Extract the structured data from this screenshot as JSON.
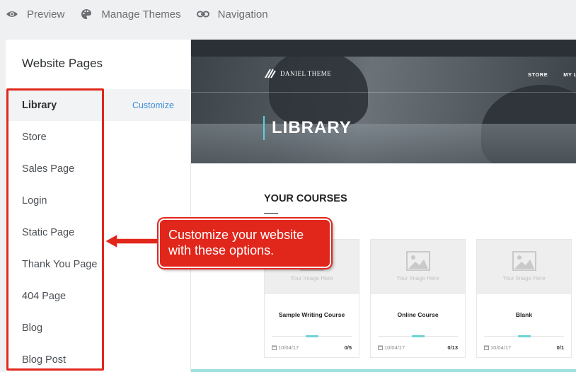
{
  "topnav": {
    "items": [
      {
        "label": "Preview",
        "icon": "eye-icon"
      },
      {
        "label": "Manage Themes",
        "icon": "palette-icon"
      },
      {
        "label": "Navigation",
        "icon": "link-icon"
      }
    ]
  },
  "sidebar": {
    "title": "Website Pages",
    "customize_label": "Customize",
    "items": [
      {
        "label": "Library",
        "active": true
      },
      {
        "label": "Store"
      },
      {
        "label": "Sales Page"
      },
      {
        "label": "Login"
      },
      {
        "label": "Static Page"
      },
      {
        "label": "Thank You Page"
      },
      {
        "label": "404 Page"
      },
      {
        "label": "Blog"
      },
      {
        "label": "Blog Post"
      }
    ]
  },
  "annotation": {
    "callout_text": "Customize your website with these options.",
    "color": "#e1261c"
  },
  "preview": {
    "logo_text": "DANIEL THEME",
    "menu": [
      "STORE",
      "MY L"
    ],
    "hero_title": "LIBRARY",
    "accent": "#5fd0d8",
    "section_title": "YOUR COURSES",
    "cards": [
      {
        "image_text": "Your Image Here",
        "title": "Sample Writing Course",
        "date": "10/04/17",
        "count": "0/5",
        "progress": 0
      },
      {
        "image_text": "Your Image Here",
        "title": "Online Course",
        "date": "10/04/17",
        "count": "0/13",
        "progress": 0
      },
      {
        "image_text": "Your Image Here",
        "title": "Blank",
        "date": "10/04/17",
        "count": "0/1",
        "progress": 0
      }
    ]
  }
}
